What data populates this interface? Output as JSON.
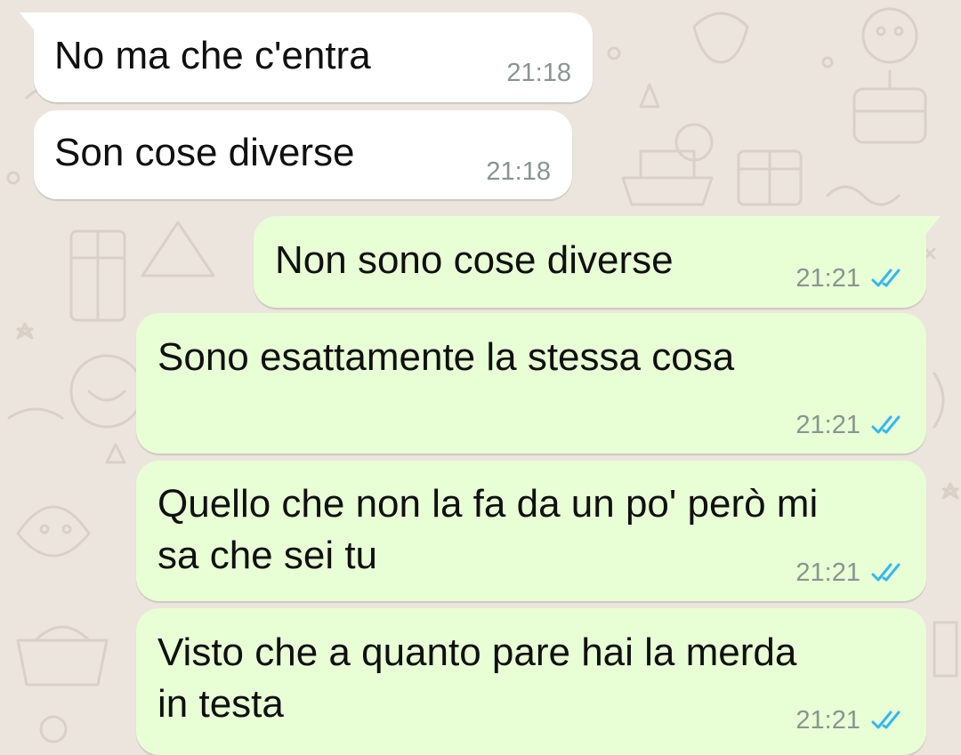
{
  "colors": {
    "wallpaper": "#ece5dd",
    "incoming_bubble": "#ffffff",
    "outgoing_bubble": "#e8ffd6",
    "read_ticks": "#34b7f1",
    "timestamp": "#8a948f"
  },
  "messages": [
    {
      "direction": "incoming",
      "text": "No ma che c'entra",
      "time": "21:18"
    },
    {
      "direction": "incoming",
      "text": "Son cose diverse",
      "time": "21:18"
    },
    {
      "direction": "outgoing",
      "text": "Non sono cose diverse",
      "time": "21:21",
      "status_icon": "double-check-read-icon"
    },
    {
      "direction": "outgoing",
      "text": "Sono esattamente la stessa cosa",
      "time": "21:21",
      "status_icon": "double-check-read-icon"
    },
    {
      "direction": "outgoing",
      "text": "Quello che non la fa da un po' però mi\nsa che sei tu",
      "time": "21:21",
      "status_icon": "double-check-read-icon"
    },
    {
      "direction": "outgoing",
      "text": "Visto che a quanto pare hai la merda\nin testa",
      "time": "21:21",
      "status_icon": "double-check-read-icon"
    }
  ]
}
